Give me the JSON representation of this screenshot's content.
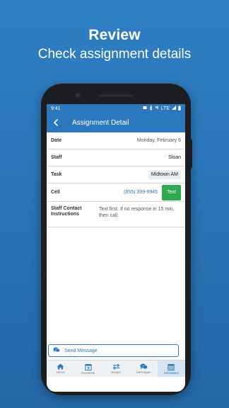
{
  "promo": {
    "title": "Review",
    "subtitle": "Check assignment details"
  },
  "status_bar": {
    "time": "9:41",
    "network": "LTE"
  },
  "header": {
    "title": "Assignment Detail"
  },
  "details": {
    "date_label": "Date",
    "date_value": "Monday, February 6",
    "staff_label": "Staff",
    "staff_value": "Sloan",
    "task_label": "Task",
    "task_value": "Midtown AM",
    "cell_label": "Cell",
    "cell_value": "(855) 399-9945",
    "text_button": "Text",
    "instructions_label": "Staff Contact Instructions",
    "instructions_value": "Text first. If no response in 15 min, then call."
  },
  "send_message": {
    "label": "Send Message"
  },
  "tabs": [
    {
      "label": "Home",
      "icon": "home-icon",
      "active": false
    },
    {
      "label": "Requests",
      "icon": "calendar-plus-icon",
      "active": false
    },
    {
      "label": "Swaps",
      "icon": "swap-arrows-icon",
      "active": false
    },
    {
      "label": "Messages",
      "icon": "chat-bubbles-icon",
      "active": false
    },
    {
      "label": "Schedules",
      "icon": "calendar-grid-icon",
      "active": true
    }
  ],
  "colors": {
    "brand_blue": "#2b78bf",
    "text_button_green": "#30a955",
    "background": "#2a74b6"
  }
}
